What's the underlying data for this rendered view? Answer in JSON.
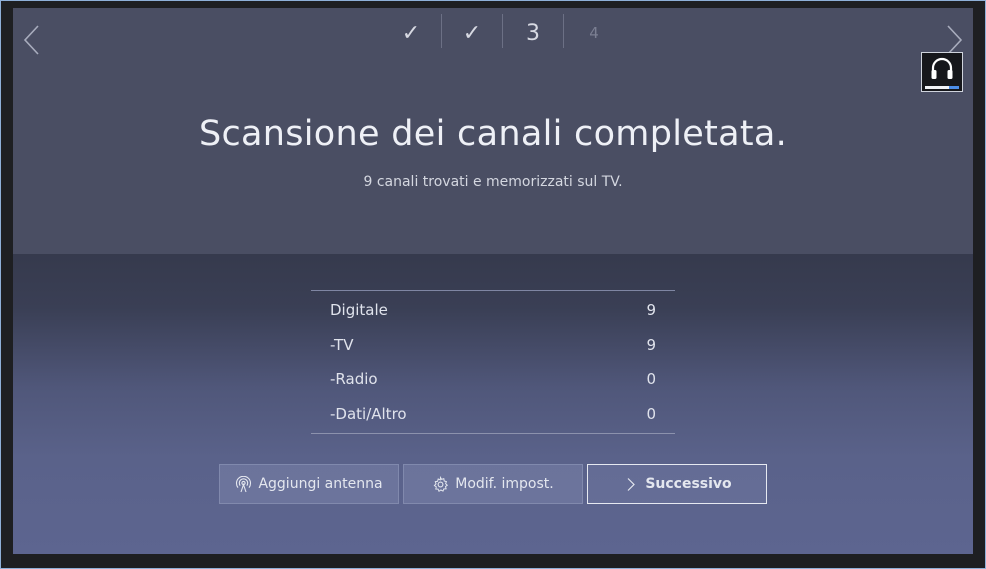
{
  "steps": {
    "step1": "✓",
    "step2": "✓",
    "step3": "3",
    "step4": "4"
  },
  "header": {
    "title": "Scansione dei canali completata.",
    "subtitle": "9  canali trovati e memorizzati sul TV."
  },
  "results": [
    {
      "label": "Digitale",
      "value": "9"
    },
    {
      "label": "-TV",
      "value": "9"
    },
    {
      "label": "-Radio",
      "value": "0"
    },
    {
      "label": "-Dati/Altro",
      "value": "0"
    }
  ],
  "buttons": {
    "add_antenna": "Aggiungi antenna",
    "modify_settings": "Modif. impost.",
    "next": "Successivo"
  },
  "icons": {
    "back": "chevron-left-icon",
    "forward": "chevron-right-icon",
    "headset": "headset-icon",
    "antenna": "antenna-icon",
    "settings": "gear-icon",
    "next": "chevron-right-icon"
  },
  "colors": {
    "accent": "#4c8de8",
    "focus_border": "#e6e9f1"
  }
}
